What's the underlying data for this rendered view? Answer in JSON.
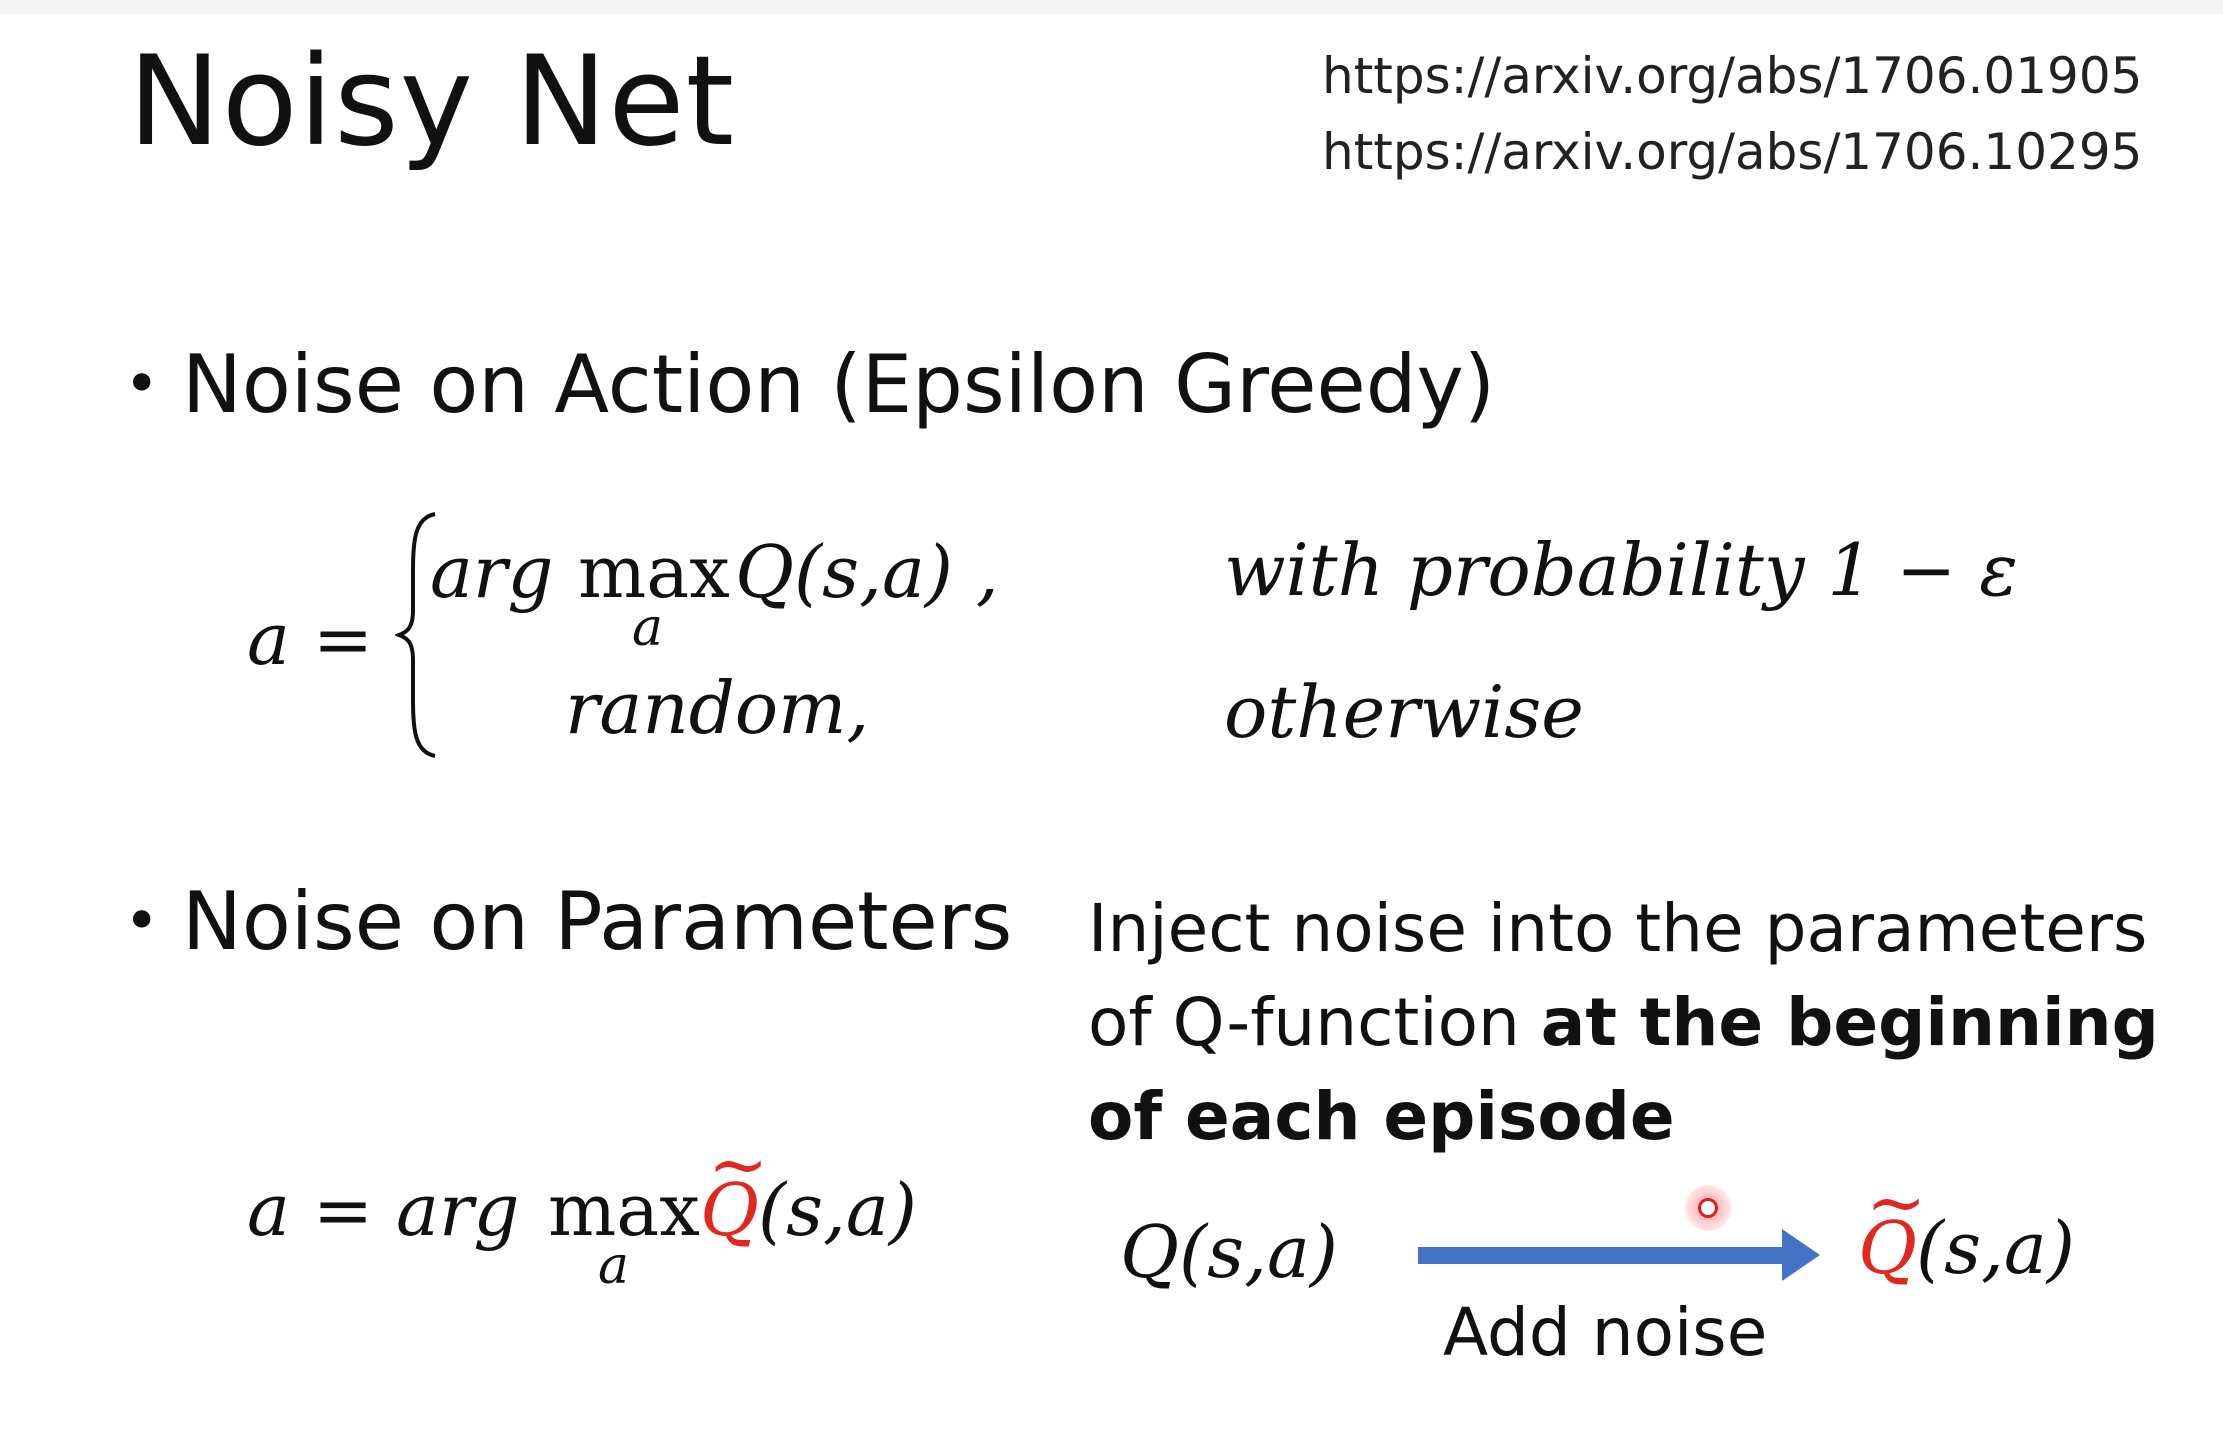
{
  "slide": {
    "title": "Noisy Net",
    "references": [
      "https://arxiv.org/abs/1706.01905",
      "https://arxiv.org/abs/1706.10295"
    ]
  },
  "bullets": [
    {
      "text": "Noise on Action (Epsilon Greedy)"
    },
    {
      "text": "Noise on Parameters"
    }
  ],
  "equation1": {
    "lhs": "a =",
    "case1_expr": "arg",
    "case1_max": "max",
    "case1_sub": "a",
    "case1_q": "Q(s,a) ,",
    "case1_condition": "with probability 1 − ε",
    "case2_expr": "random,",
    "case2_condition": "otherwise"
  },
  "equation2": {
    "lhs": "a = arg",
    "max": "max",
    "sub": "a",
    "q": "Q",
    "tilde": "~",
    "args": "(s,a)"
  },
  "description": {
    "normal": "Inject noise into the parameters of Q-function ",
    "bold": "at the beginning of each episode"
  },
  "diagram": {
    "from": "Q(s,a)",
    "to_q": "Q",
    "to_tilde": "~",
    "to_args": "(s,a)",
    "arrow_label": "Add noise",
    "arrow_color": "#4472c4",
    "highlight_color": "#e0281e"
  }
}
